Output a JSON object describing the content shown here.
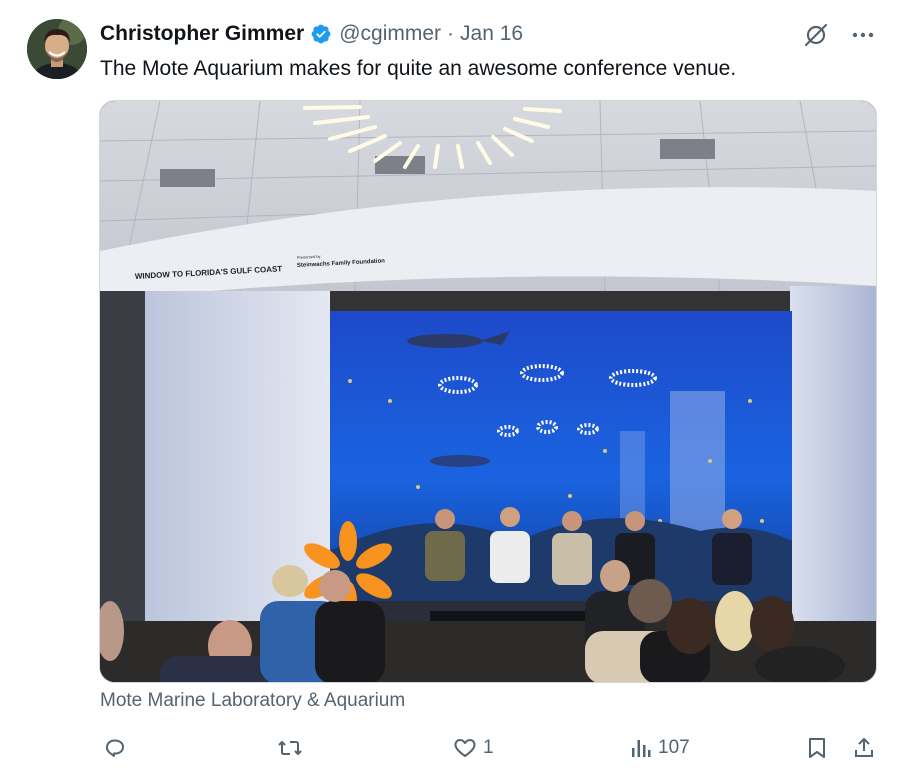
{
  "author": {
    "name": "Christopher Gimmer",
    "handle": "@cgimmer",
    "separator": "·",
    "date": "Jan 16",
    "verified": true
  },
  "tweet": {
    "text": "The Mote Aquarium makes for quite an awesome conference venue."
  },
  "media": {
    "banner_left": "WINDOW TO FLORIDA'S GULF COAST",
    "banner_presented": "Presented by",
    "banner_sponsor": "Steinwachs Family Foundation"
  },
  "location": {
    "label": "Mote Marine Laboratory & Aquarium"
  },
  "actions": {
    "reply_count": "",
    "repost_count": "",
    "like_count": "1",
    "views_count": "107"
  },
  "icons": {
    "verified": "verified-badge-icon",
    "grok": "grok-icon",
    "more": "more-icon",
    "reply": "reply-icon",
    "repost": "repost-icon",
    "like": "heart-icon",
    "views": "views-icon",
    "bookmark": "bookmark-icon",
    "share": "share-icon"
  },
  "colors": {
    "text": "#0f1419",
    "secondary": "#536471",
    "verified_blue": "#1d9bf0",
    "tank_blue": "#1a56d6"
  }
}
